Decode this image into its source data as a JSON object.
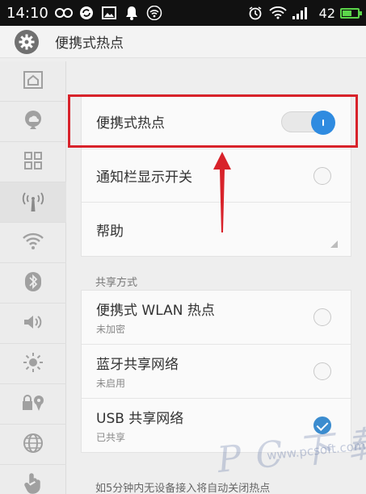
{
  "status_bar": {
    "time": "14:10",
    "battery": "42",
    "icons": [
      "infinity-icon",
      "refresh-icon",
      "image-icon",
      "bell-icon",
      "wifi-icon",
      "alarm-icon",
      "wifi-icon",
      "signal-icon",
      "battery-icon"
    ]
  },
  "title_bar": {
    "icon": "gear-icon",
    "title": "便携式热点"
  },
  "side_tabs": [
    {
      "icon": "home-icon",
      "active": false
    },
    {
      "icon": "cloud-location-icon",
      "active": false
    },
    {
      "icon": "grid-icon",
      "active": false
    },
    {
      "icon": "hotspot-icon",
      "active": true
    },
    {
      "icon": "wifi-icon",
      "active": false
    },
    {
      "icon": "bluetooth-icon",
      "active": false
    },
    {
      "icon": "volume-icon",
      "active": false
    },
    {
      "icon": "brightness-icon",
      "active": false
    },
    {
      "icon": "lock-location-icon",
      "active": false
    },
    {
      "icon": "globe-icon",
      "active": false
    },
    {
      "icon": "hand-icon",
      "active": false
    }
  ],
  "main_card": {
    "hotspot": {
      "label": "便携式热点",
      "on": true
    },
    "notify": {
      "label": "通知栏显示开关",
      "checked": false
    },
    "help": {
      "label": "帮助"
    }
  },
  "share_section": {
    "label": "共享方式",
    "items": [
      {
        "label": "便携式 WLAN 热点",
        "sub": "未加密",
        "checked": false
      },
      {
        "label": "蓝牙共享网络",
        "sub": "未启用",
        "checked": false
      },
      {
        "label": "USB 共享网络",
        "sub": "已共享",
        "checked": true
      }
    ]
  },
  "footer_note": "如5分钟内无设备接入将自动关闭热点",
  "annotation": {
    "color": "#d8222a"
  },
  "watermark": {
    "text": "P C 下 载 网",
    "url": "www.pcsoft.com.cn"
  },
  "colors": {
    "accent": "#2f8be0",
    "highlight": "#d8222a"
  }
}
